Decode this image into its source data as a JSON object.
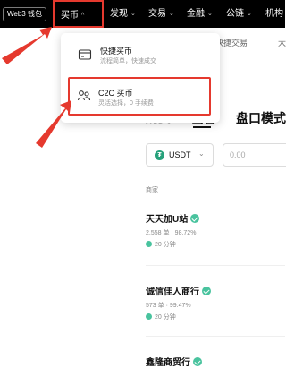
{
  "topbar": {
    "web3_label": "Web3 钱包",
    "nav": [
      {
        "label": "买币",
        "chevron": "^"
      },
      {
        "label": "发现",
        "chevron": "⌄"
      },
      {
        "label": "交易",
        "chevron": "⌄"
      },
      {
        "label": "金融",
        "chevron": "⌄"
      },
      {
        "label": "公链",
        "chevron": "⌄"
      },
      {
        "label": "机构",
        "chevron": ""
      }
    ]
  },
  "dropdown": {
    "items": [
      {
        "title": "快捷买币",
        "subtitle": "流程简单，快速成交",
        "icon": "card-icon"
      },
      {
        "title": "C2C 买币",
        "subtitle": "灵活选择，0 手续费",
        "icon": "people-icon"
      }
    ]
  },
  "page": {
    "subtabs": [
      "快捷交易",
      "大"
    ],
    "trade_tabs": [
      "购买",
      "出售",
      "盘口模式"
    ],
    "coin": {
      "label": "USDT",
      "symbol": "₮"
    },
    "amount_placeholder": "0.00",
    "merchant_header": "商家",
    "merchants": [
      {
        "name": "天天加U站",
        "stats": "2,558 单 · 98.72%",
        "time": "20 分钟"
      },
      {
        "name": "诚信佳人商行",
        "stats": "573 单 · 99.47%",
        "time": "20 分钟"
      },
      {
        "name": "鑫隆商贸行",
        "stats": "",
        "time": ""
      }
    ]
  },
  "colors": {
    "annotation": "#e5392e",
    "topbar": "#000000",
    "verified": "#49c39e",
    "usdt": "#26a17b"
  }
}
